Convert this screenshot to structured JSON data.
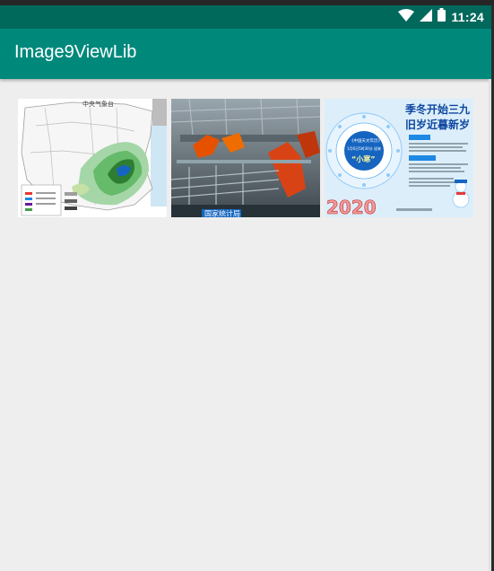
{
  "status_bar": {
    "time": "11:24",
    "icons": [
      "wifi-icon",
      "cell-signal-icon",
      "battery-icon"
    ]
  },
  "app_bar": {
    "title": "Image9ViewLib"
  },
  "colors": {
    "status_bar": "#00695c",
    "app_bar": "#00897b",
    "background": "#eeeeee"
  },
  "images": [
    {
      "name": "weather-map-image",
      "title": "中央气象台"
    },
    {
      "name": "factory-robots-image",
      "caption": "国家统计局"
    },
    {
      "name": "solar-term-poster-image",
      "headline_1": "季冬开始三九",
      "headline_2": "旧岁近暮新岁",
      "center_title": "《中国天文年历》",
      "center_line": "1月6日5时30分 迎来",
      "term": "“小寒”",
      "year": "2020"
    }
  ]
}
